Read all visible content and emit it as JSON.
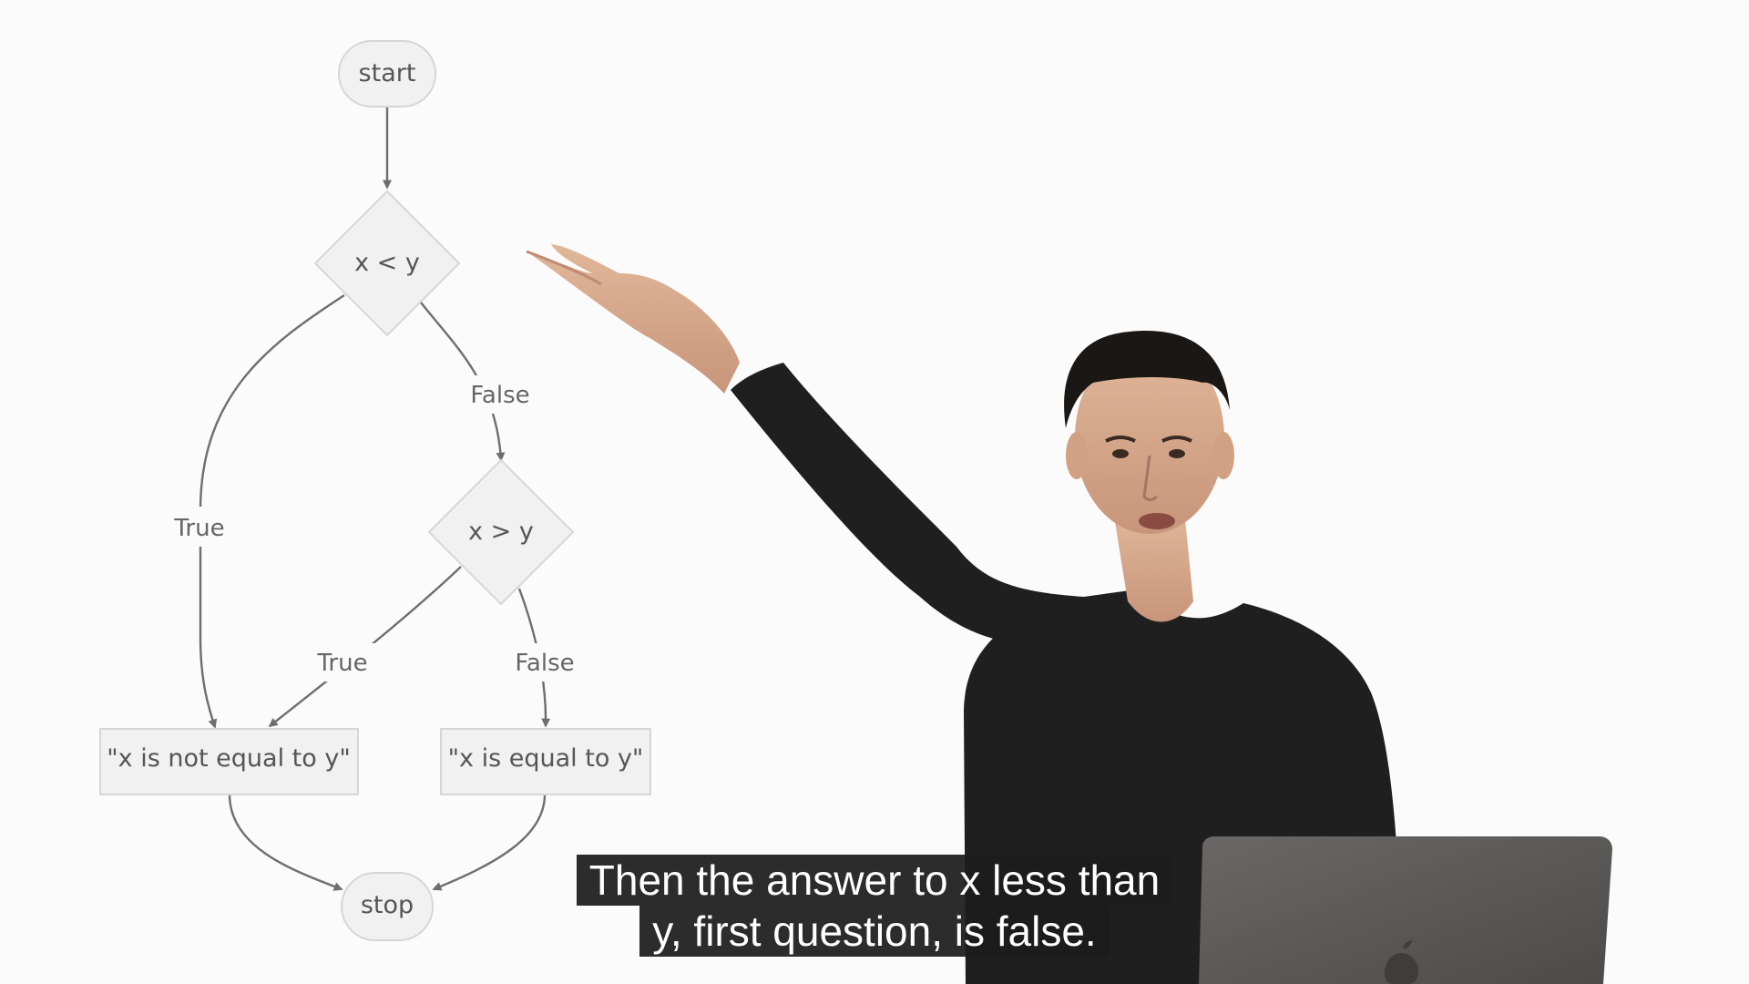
{
  "diagram": {
    "nodes": {
      "start": "start",
      "cond1": "x < y",
      "cond2": "x > y",
      "not_equal": "\"x is not equal to y\"",
      "equal": "\"x is equal to y\"",
      "stop": "stop"
    },
    "edge_labels": {
      "cond1_true": "True",
      "cond1_false": "False",
      "cond2_true": "True",
      "cond2_false": "False"
    }
  },
  "subtitles": {
    "line1": "Then the answer to x less than",
    "line2": "y, first question, is false."
  },
  "colors": {
    "background": "#fbfbfb",
    "node_fill": "#f1f1f1",
    "node_stroke": "#d6d6d6",
    "edge": "#6e6e6e",
    "subtitle_bg": "#1c1c1c",
    "subtitle_text": "#ffffff",
    "shirt": "#1e1e1e",
    "laptop": "#5b5a58"
  }
}
